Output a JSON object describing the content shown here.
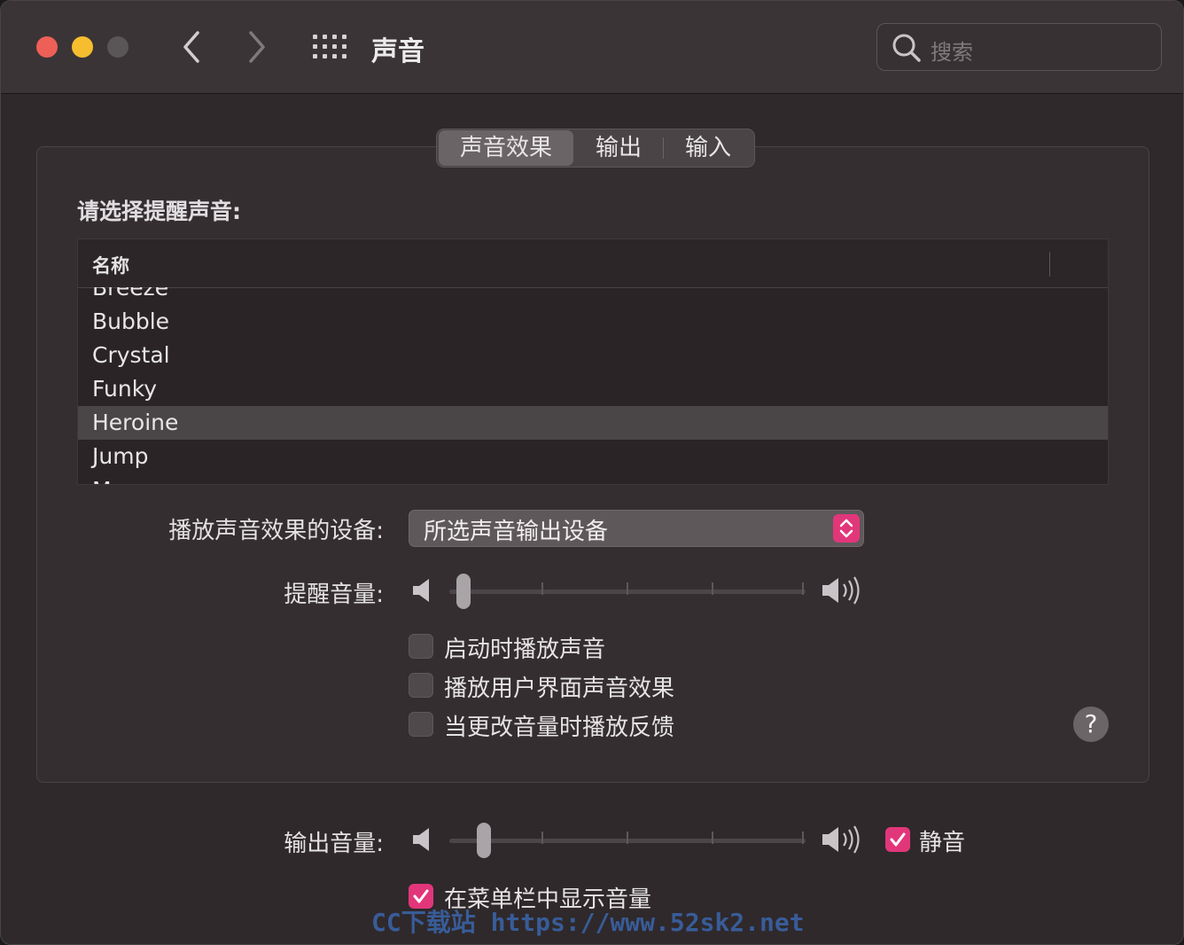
{
  "window": {
    "title": "声音",
    "search_placeholder": "搜索"
  },
  "tabs": [
    {
      "label": "声音效果",
      "active": true
    },
    {
      "label": "输出",
      "active": false
    },
    {
      "label": "输入",
      "active": false
    }
  ],
  "alert": {
    "section_label": "请选择提醒声音:",
    "column_name": "名称",
    "sounds": [
      "Breeze",
      "Bubble",
      "Crystal",
      "Funky",
      "Heroine",
      "Jump",
      "Morse"
    ],
    "selected": "Heroine"
  },
  "device": {
    "label": "播放声音效果的设备:",
    "value": "所选声音输出设备"
  },
  "alert_volume": {
    "label": "提醒音量:",
    "level": 0.02
  },
  "checkboxes": [
    {
      "label": "启动时播放声音",
      "checked": false
    },
    {
      "label": "播放用户界面声音效果",
      "checked": false
    },
    {
      "label": "当更改音量时播放反馈",
      "checked": false
    }
  ],
  "help_label": "?",
  "output_volume": {
    "label": "输出音量:",
    "level": 0.08,
    "mute_label": "静音",
    "mute_checked": true
  },
  "menubar_volume": {
    "label": "在菜单栏中显示音量",
    "checked": true
  },
  "watermark": "CC下载站 https://www.52sk2.net",
  "colors": {
    "accent": "#e2367a",
    "window_bg": "#2f292b",
    "selection": "#4a4547"
  }
}
